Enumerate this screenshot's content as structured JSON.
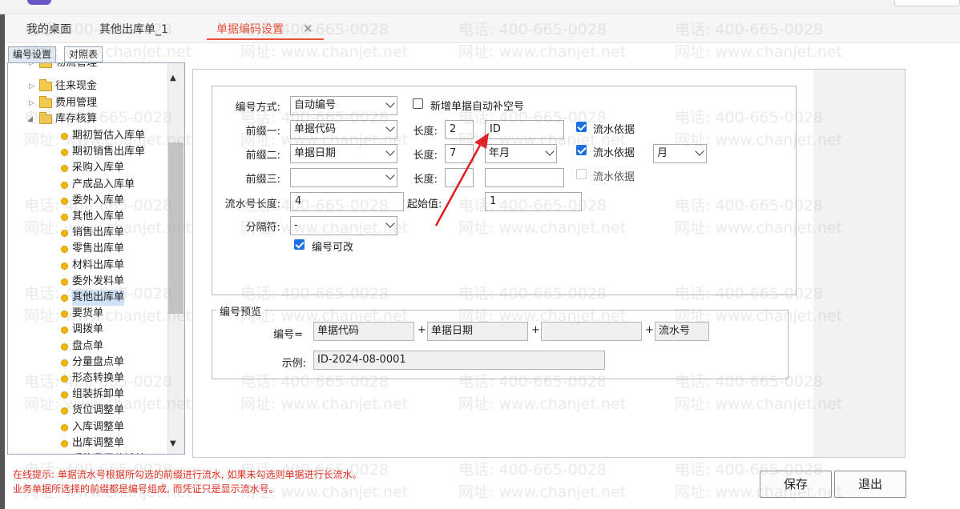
{
  "tabs": [
    {
      "label": "我的桌面"
    },
    {
      "label": "其他出库单_1"
    },
    {
      "label": "单据编码设置"
    }
  ],
  "subtabs": [
    "编号设置",
    "对照表"
  ],
  "tree": {
    "folders": [
      "物流管理",
      "往来现金",
      "费用管理",
      "库存核算"
    ],
    "items": [
      "期初暂估入库单",
      "期初销售出库单",
      "采购入库单",
      "产成品入库单",
      "委外入库单",
      "其他入库单",
      "销售出库单",
      "零售出库单",
      "材料出库单",
      "委外发料单",
      "其他出库单",
      "要货单",
      "调拨单",
      "盘点单",
      "分量盘点单",
      "形态转换单",
      "组装拆卸单",
      "货位调整单",
      "入库调整单",
      "出库调整单",
      "采购费用分摊单"
    ],
    "selected": "其他出库单"
  },
  "form": {
    "mode_label": "编号方式:",
    "mode_value": "自动编号",
    "auto_fill_label": "新增单据自动补空号",
    "prefix1_label": "前缀一:",
    "prefix1_value": "单据代码",
    "prefix2_label": "前缀二:",
    "prefix2_value": "单据日期",
    "prefix3_label": "前缀三:",
    "prefix3_value": "",
    "length_label": "长度:",
    "prefix1_length": "2",
    "prefix1_text": "ID",
    "prefix2_length": "7",
    "prefix2_format": "年月",
    "prefix3_length": "",
    "prefix3_text": "",
    "serial_basis_label": "流水依据",
    "serial_period": "月",
    "serial_length_label": "流水号长度:",
    "serial_length": "4",
    "start_label": "起始值:",
    "start_value": "1",
    "separator_label": "分隔符:",
    "separator_value": "-",
    "editable_label": "编号可改"
  },
  "preview": {
    "title": "编号预览",
    "number_label": "编号=",
    "parts": [
      "单据代码",
      "单据日期",
      "",
      "流水号"
    ],
    "plus": "+",
    "example_label": "示例:",
    "example_value": "ID-2024-08-0001"
  },
  "hints": {
    "line1": "在线提示: 单据流水号根据所勾选的前缀进行流水, 如果未勾选则单据进行长流水。",
    "line2": "业务单据所选择的前缀都是编号组成, 而凭证只是显示流水号。"
  },
  "buttons": {
    "save": "保存",
    "exit": "退出"
  },
  "watermark": {
    "phone": "电话: 400-665-0028",
    "site": "网址: www.chanjet.net"
  },
  "colors": {
    "accent": "#e8503b",
    "checkbox": "#1a6fe0",
    "hint": "#e12b1e"
  }
}
